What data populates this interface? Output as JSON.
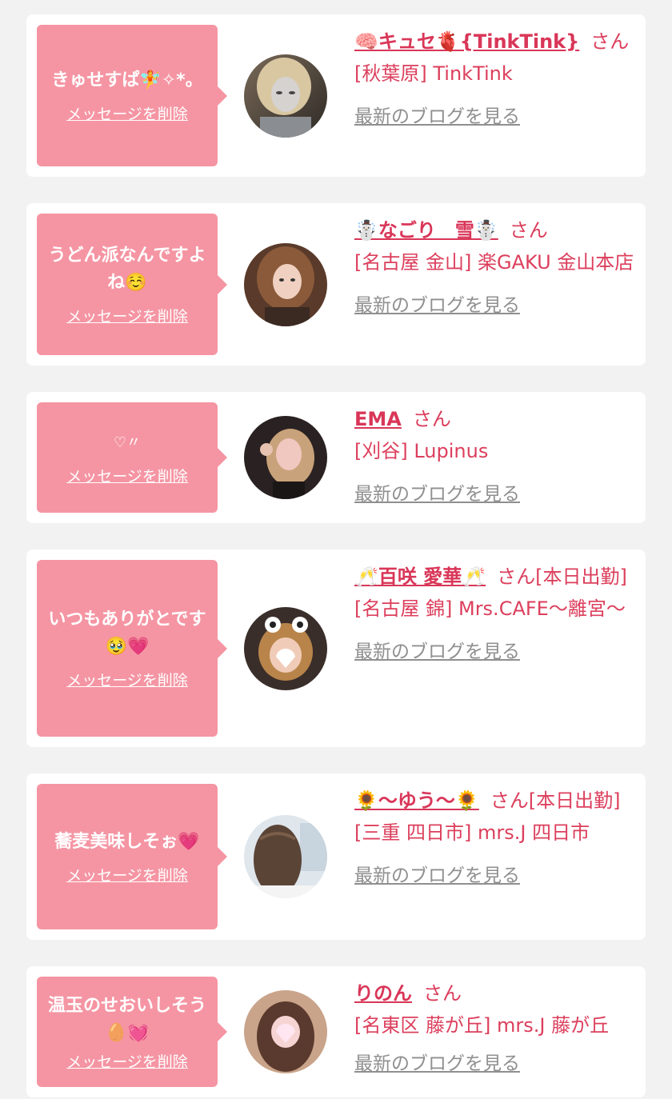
{
  "delete_label": "メッセージを削除",
  "blog_label": "最新のブログを見る",
  "suffix": "さん",
  "messages": [
    {
      "bubble": "きゅせすぱ🧚✧*。",
      "name": "🧠キュセ🫀{TinkTink}",
      "status": "",
      "shop": "[秋葉原] TinkTink"
    },
    {
      "bubble": "うどん派なんですよね☺️",
      "name": "☃️なごり　雪☃️",
      "status": "",
      "shop": "[名古屋 金山] 楽GAKU 金山本店"
    },
    {
      "bubble": "♡〃",
      "name": "EMA",
      "status": "",
      "shop": "[刈谷] Lupinus"
    },
    {
      "bubble": "いつもありがとです🥹💗",
      "name": "🥂百咲 愛華🥂",
      "status": "[本日出勤]",
      "shop": "[名古屋 錦] Mrs.CAFE〜離宮〜"
    },
    {
      "bubble": "蕎麦美味しそぉ💗",
      "name": "🌻〜ゆう〜🌻",
      "status": "[本日出勤]",
      "shop": "[三重 四日市] mrs.J 四日市"
    },
    {
      "bubble": "温玉のせおいしそう🥚💓",
      "name": "りのん",
      "status": "",
      "shop": "[名東区 藤が丘] mrs.J 藤が丘"
    }
  ]
}
